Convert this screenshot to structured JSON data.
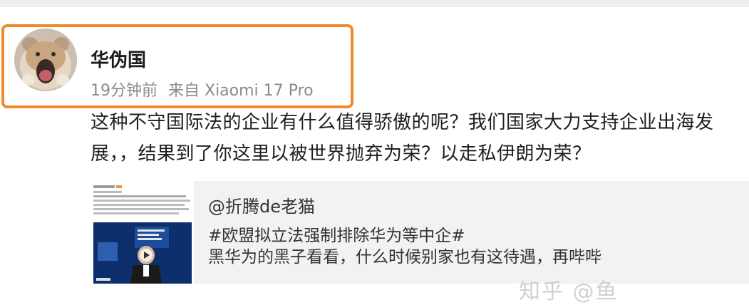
{
  "post": {
    "author_name": "华伪国",
    "time_ago": "19分钟前",
    "source": "来自 Xiaomi 17 Pro",
    "text": "这种不守国际法的企业有什么值得骄傲的呢？我们国家大力支持企业出海发展，，结果到了你这里以被世界抛弃为荣？以走私伊朗为荣？"
  },
  "repost": {
    "author": "@折腾de老猫",
    "topic": "#欧盟拟立法强制排除华为等中企#",
    "line": "黑华为的黑子看看，什么时候别家也有这待遇，再哔哔"
  },
  "watermark": "知乎 @鱼",
  "colors": {
    "highlight_border": "#f08a2b",
    "meta_gray": "#8a8a8a",
    "card_bg": "#f2f2f2"
  },
  "icons": {
    "avatar": "hamster-avatar",
    "thumbnail": "news-video-thumbnail"
  }
}
